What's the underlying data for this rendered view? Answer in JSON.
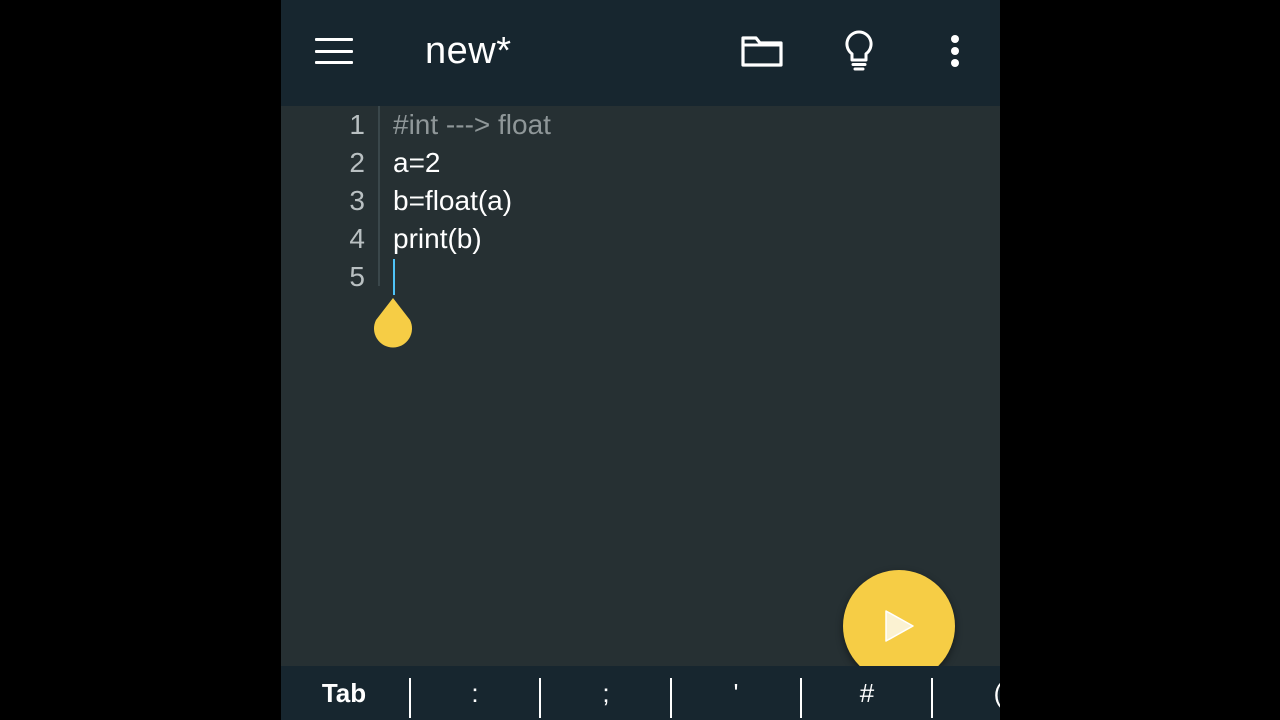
{
  "toolbar": {
    "title": "new*",
    "icons": [
      "menu-icon",
      "folder-icon",
      "lightbulb-icon",
      "more-vert-icon"
    ]
  },
  "editor": {
    "lines": [
      {
        "number": "1",
        "text": "#int ---> float",
        "kind": "comment"
      },
      {
        "number": "2",
        "text": "a=2",
        "kind": "code"
      },
      {
        "number": "3",
        "text": "b=float(a)",
        "kind": "code"
      },
      {
        "number": "4",
        "text": "print(b)",
        "kind": "code"
      },
      {
        "number": "5",
        "text": "",
        "kind": "code"
      }
    ]
  },
  "fab": {
    "icon": "play-icon"
  },
  "keybar": {
    "keys": [
      "Tab",
      ":",
      ";",
      "'",
      "#",
      "("
    ]
  },
  "colors": {
    "appbar": "#17262f",
    "editor_bg": "#263033",
    "accent": "#f6cd45",
    "cursor": "#4fc3f7",
    "comment": "#8f9799"
  }
}
